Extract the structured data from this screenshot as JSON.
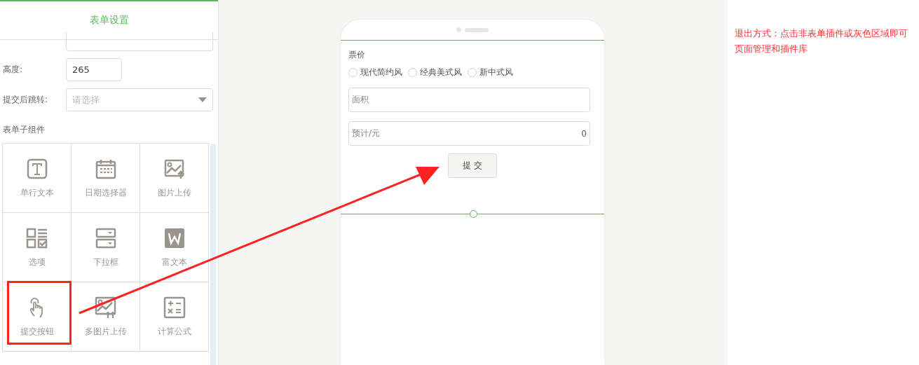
{
  "left_panel": {
    "title": "表单设置",
    "fields": [
      {
        "kind": "text",
        "label": "高度:",
        "value": "265"
      },
      {
        "kind": "select",
        "label": "提交后跳转:",
        "placeholder": "请选择"
      }
    ],
    "section_title": "表单子组件",
    "components": [
      {
        "kind": "text",
        "label": "单行文本",
        "highlighted": false
      },
      {
        "kind": "date",
        "label": "日期选择器",
        "highlighted": false
      },
      {
        "kind": "image",
        "label": "图片上传",
        "highlighted": false
      },
      {
        "kind": "options",
        "label": "选项",
        "highlighted": false
      },
      {
        "kind": "dropdown",
        "label": "下拉框",
        "highlighted": false
      },
      {
        "kind": "richtext",
        "label": "富文本",
        "highlighted": false
      },
      {
        "kind": "submit",
        "label": "提交按钮",
        "highlighted": true
      },
      {
        "kind": "images",
        "label": "多图片上传",
        "highlighted": false
      },
      {
        "kind": "formula",
        "label": "计算公式",
        "highlighted": false
      }
    ]
  },
  "phone": {
    "group_label": "票价",
    "options": [
      {
        "label": "现代简约风",
        "selected": false
      },
      {
        "label": "经典美式风",
        "selected": false
      },
      {
        "label": "新中式风",
        "selected": false
      }
    ],
    "inputs": [
      {
        "placeholder": "面积"
      },
      {
        "label": "预计/元",
        "value": "0"
      }
    ],
    "submit_button": "提 交"
  },
  "hint": {
    "lines": [
      "退出方式：点击非表单插件或灰色区域即可",
      "页面管理和插件库"
    ]
  }
}
